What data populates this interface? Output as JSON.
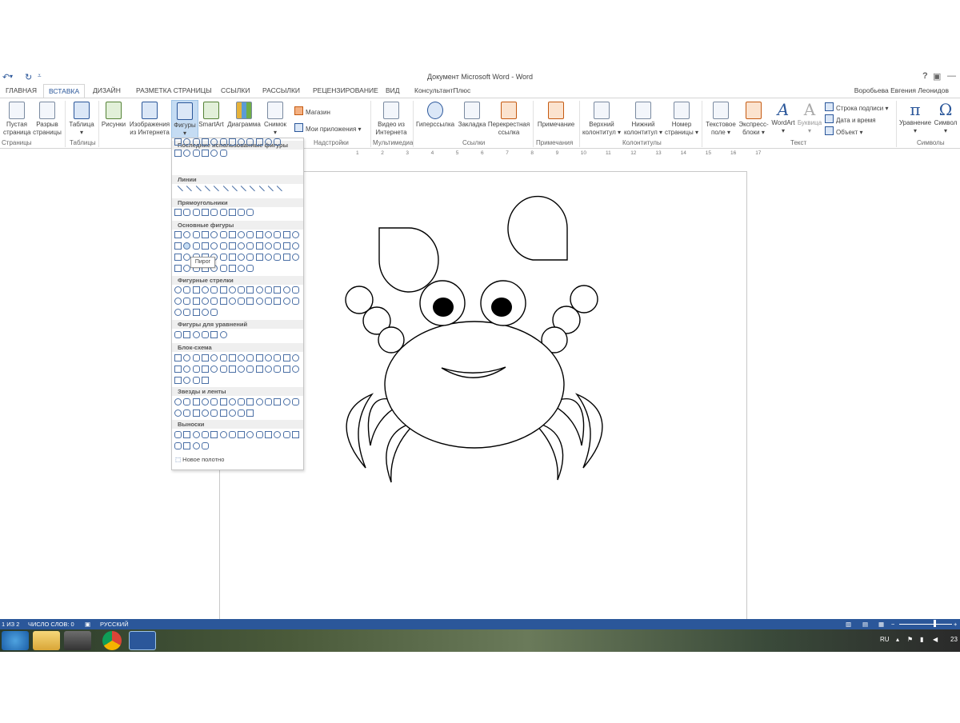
{
  "window": {
    "title": "Документ Microsoft Word - Word",
    "help": "?",
    "user": "Воробьева Евгения Леонидов"
  },
  "tabs": [
    "ГЛАВНАЯ",
    "ВСТАВКА",
    "ДИЗАЙН",
    "РАЗМЕТКА СТРАНИЦЫ",
    "ССЫЛКИ",
    "РАССЫЛКИ",
    "РЕЦЕНЗИРОВАНИЕ",
    "ВИД",
    "КонсультантПлюс"
  ],
  "ribbon": {
    "blank_page": [
      "Пустая",
      "страница"
    ],
    "page_break": [
      "Разрыв",
      "страницы"
    ],
    "table": [
      "Таблица"
    ],
    "pictures": [
      "Рисунки"
    ],
    "online_pictures": [
      "Изображения",
      "из Интернета"
    ],
    "shapes": [
      "Фигуры"
    ],
    "smartart": [
      "SmartArt"
    ],
    "chart": [
      "Диаграмма"
    ],
    "screenshot": [
      "Снимок"
    ],
    "store": "Магазин",
    "my_apps": "Мои приложения",
    "online_video": [
      "Видео из",
      "Интернета"
    ],
    "hyperlink": [
      "Гиперссылка"
    ],
    "bookmark": [
      "Закладка"
    ],
    "cross_reference": [
      "Перекрестная",
      "ссылка"
    ],
    "comment": [
      "Примечание"
    ],
    "header": [
      "Верхний",
      "колонтитул"
    ],
    "footer": [
      "Нижний",
      "колонтитул"
    ],
    "page_number": [
      "Номер",
      "страницы"
    ],
    "text_box": [
      "Текстовое",
      "поле"
    ],
    "quick_parts": [
      "Экспресс-",
      "блоки"
    ],
    "wordart": [
      "WordArt"
    ],
    "drop_cap": [
      "Буквица"
    ],
    "signature_line": "Строка подписи",
    "date_time": "Дата и время",
    "object": "Объект",
    "equation": [
      "Уравнение"
    ],
    "symbol": [
      "Символ"
    ],
    "groups": {
      "pages": "Страницы",
      "tables": "Таблицы",
      "addins": "Надстройки",
      "media": "Мультимедиа",
      "links": "Ссылки",
      "comments": "Примечания",
      "header_footer": "Колонтитулы",
      "text": "Текст",
      "symbols": "Символы"
    }
  },
  "ruler_ticks": [
    "1",
    "2",
    "3",
    "4",
    "5",
    "6",
    "7",
    "8",
    "9",
    "10",
    "11",
    "12",
    "13",
    "14",
    "15",
    "16",
    "17"
  ],
  "shapes_gallery": {
    "sections": [
      "Последние использованные фигуры",
      "Линии",
      "Прямоугольники",
      "Основные фигуры",
      "Фигурные стрелки",
      "Фигуры для уравнений",
      "Блок-схема",
      "Звезды и ленты",
      "Выноски"
    ],
    "tooltip": "Пирог",
    "new_canvas": "Новое полотно"
  },
  "status": {
    "page": "1 ИЗ 2",
    "words": "ЧИСЛО СЛОВ: 0",
    "language": "РУССКИЙ"
  },
  "taskbar": {
    "lang": "RU",
    "clock": "23"
  },
  "colors": {
    "accent": "#2b579a",
    "ribbon_selected": "#c5dcf3"
  }
}
